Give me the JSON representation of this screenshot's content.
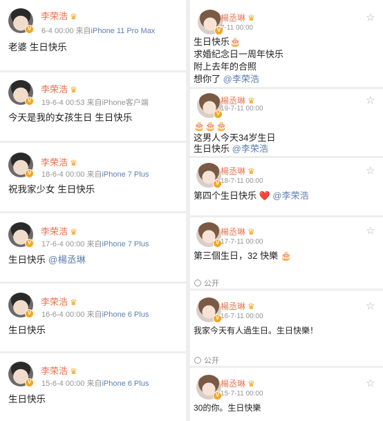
{
  "left_posts": [
    {
      "name": "李荣浩",
      "meta_time": "6-4 00:00",
      "meta_from": "来自",
      "device": "iPhone 11 Pro Max",
      "text": "老婆 生日快乐"
    },
    {
      "name": "李荣浩",
      "meta_time": "19-6-4 00:53",
      "meta_from": "来自",
      "device": "iPhone客户端",
      "text": "今天是我的女孩生日 生日快乐"
    },
    {
      "name": "李荣浩",
      "meta_time": "18-6-4 00:00",
      "meta_from": "来自",
      "device": "iPhone 7 Plus",
      "text": "祝我家少女 生日快乐"
    },
    {
      "name": "李荣浩",
      "meta_time": "17-6-4 00:00",
      "meta_from": "来自",
      "device": "iPhone 7 Plus",
      "text": "生日快乐",
      "mention": "@楊丞琳"
    },
    {
      "name": "李荣浩",
      "meta_time": "16-6-4 00:00",
      "meta_from": "来自",
      "device": "iPhone 6 Plus",
      "text": "生日快乐"
    },
    {
      "name": "李荣浩",
      "meta_time": "15-6-4 00:00",
      "meta_from": "来自",
      "device": "iPhone 6 Plus",
      "text": "生日快乐"
    }
  ],
  "right_posts": [
    {
      "name": "楊丞琳",
      "meta_time": "7-11 00:00",
      "lines": [
        "生日快乐🎂",
        "求婚纪念日一周年快乐",
        "附上去年的合照"
      ],
      "last_line": "想你了 ",
      "mention": "@李荣浩"
    },
    {
      "name": "楊丞琳",
      "meta_time": "19-7-11 00:00",
      "lines": [
        "🎂🎂🎂",
        "这男人今天34岁生日"
      ],
      "last_line": "生日快乐 ",
      "mention": "@李荣浩"
    },
    {
      "name": "楊丞琳",
      "meta_time": "18-7-11 00:00",
      "text": "第四个生日快乐 ❤️ ",
      "mention": "@李荣浩"
    },
    {
      "name": "楊丞琳",
      "meta_time": "17-7-11 00:00",
      "text": "第三個生日，32 快樂 🎂"
    },
    {
      "name": "楊丞琳",
      "meta_time": "16-7-11 00:00",
      "text": "我家今天有人過生日。生日快樂！"
    },
    {
      "name": "楊丞琳",
      "meta_time": "15-7-11 00:00",
      "text": "30的你。生日快樂"
    }
  ],
  "public_label": "公开",
  "verified_mark": "V",
  "crown_icon": "♛",
  "star_icon": "☆",
  "colors": {
    "name": "#eb7350",
    "device": "#5d7fae",
    "meta": "#939393",
    "mention": "#5d7fae",
    "badge": "#f5a623"
  }
}
